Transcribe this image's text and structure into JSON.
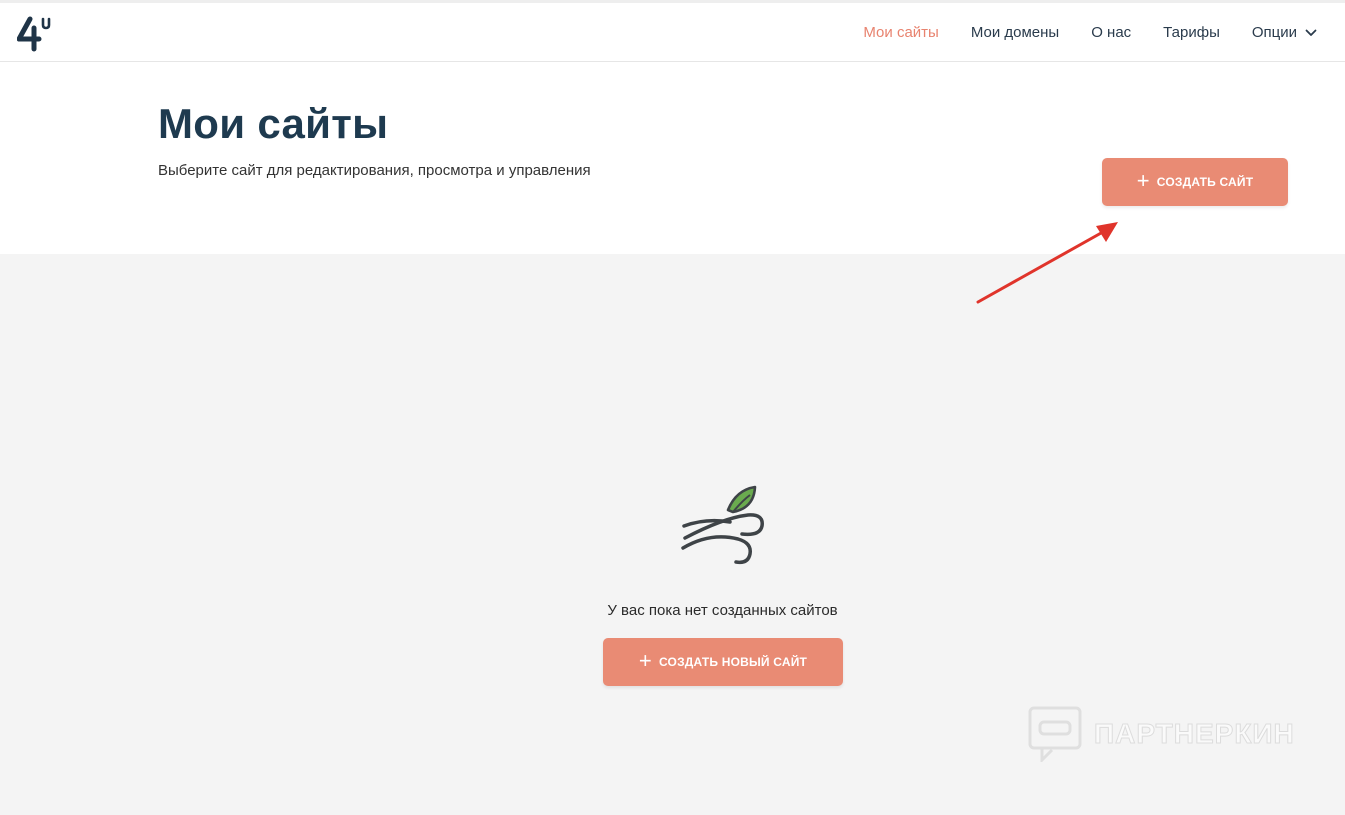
{
  "nav": {
    "items": [
      {
        "label": "Мои сайты",
        "active": true
      },
      {
        "label": "Мои домены",
        "active": false
      },
      {
        "label": "О нас",
        "active": false
      },
      {
        "label": "Тарифы",
        "active": false
      },
      {
        "label": "Опции",
        "active": false
      }
    ]
  },
  "hero": {
    "title": "Мои сайты",
    "subtitle": "Выберите сайт для редактирования, просмотра и управления",
    "create_button_label": "СОЗДАТЬ САЙТ"
  },
  "empty_state": {
    "message": "У вас пока нет созданных сайтов",
    "create_button_label": "СОЗДАТЬ НОВЫЙ САЙТ"
  },
  "watermark": {
    "text": "ПАРТНЕРКИН"
  },
  "colors": {
    "accent": "#e98b74",
    "nav_active": "#e8836f",
    "title": "#1e3a4f",
    "background_main": "#f4f4f4",
    "annotation_arrow": "#e0342b",
    "leaf_green": "#6aaa4f"
  },
  "icons": [
    "logo-4u",
    "chevron-down-icon",
    "plus-icon",
    "wind-leaf-icon",
    "annotation-arrow"
  ]
}
